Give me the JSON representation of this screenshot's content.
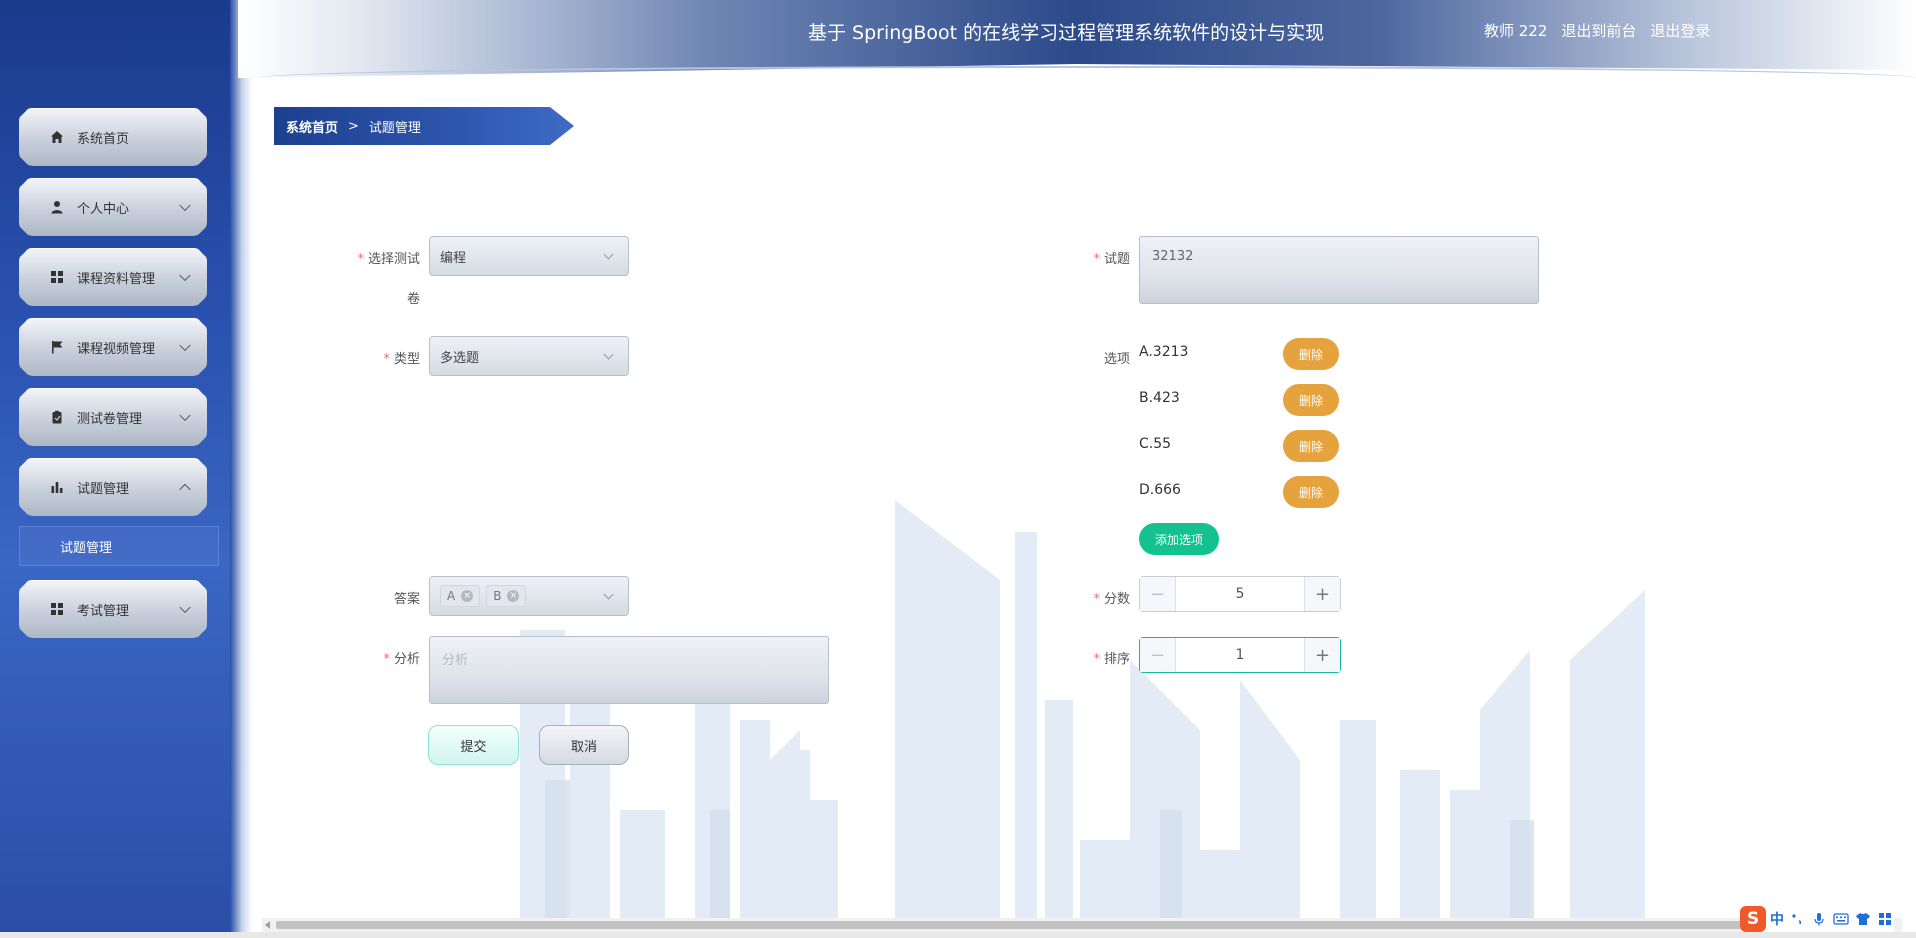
{
  "header": {
    "title": "基于 SpringBoot 的在线学习过程管理系统软件的设计与实现",
    "user": "教师 222",
    "to_front": "退出到前台",
    "logout": "退出登录"
  },
  "sidebar": {
    "items": [
      {
        "label": "系统首页",
        "icon": "home-icon"
      },
      {
        "label": "个人中心",
        "icon": "user-icon"
      },
      {
        "label": "课程资料管理",
        "icon": "grid-icon"
      },
      {
        "label": "课程视频管理",
        "icon": "flag-icon"
      },
      {
        "label": "测试卷管理",
        "icon": "clipboard-icon"
      },
      {
        "label": "试题管理",
        "icon": "bar-chart-icon"
      },
      {
        "label": "考试管理",
        "icon": "grid-icon"
      }
    ],
    "submenu": {
      "label": "试题管理"
    }
  },
  "breadcrumb": {
    "home": "系统首页",
    "separator": ">",
    "current": "试题管理"
  },
  "form": {
    "paper": {
      "label_line1": "选择测试",
      "label_line2": "卷",
      "value": "编程"
    },
    "type": {
      "label": "类型",
      "value": "多选题"
    },
    "answer": {
      "label": "答案",
      "tags": [
        "A",
        "B"
      ]
    },
    "analysis": {
      "label": "分析",
      "placeholder": "分析"
    },
    "question": {
      "label": "试题",
      "value": "32132"
    },
    "options": {
      "label": "选项",
      "items": [
        "A.3213",
        "B.423",
        "C.55",
        "D.666"
      ],
      "delete_label": "删除",
      "add_label": "添加选项"
    },
    "score": {
      "label": "分数",
      "value": "5"
    },
    "order": {
      "label": "排序",
      "value": "1"
    },
    "submit_label": "提交",
    "cancel_label": "取消"
  },
  "ime": {
    "logo": "S",
    "lang": "中"
  },
  "colors": {
    "sidebar": "#2a52b0",
    "delete": "#e6a23c",
    "add": "#13c28f",
    "required": "#f56c6c"
  }
}
